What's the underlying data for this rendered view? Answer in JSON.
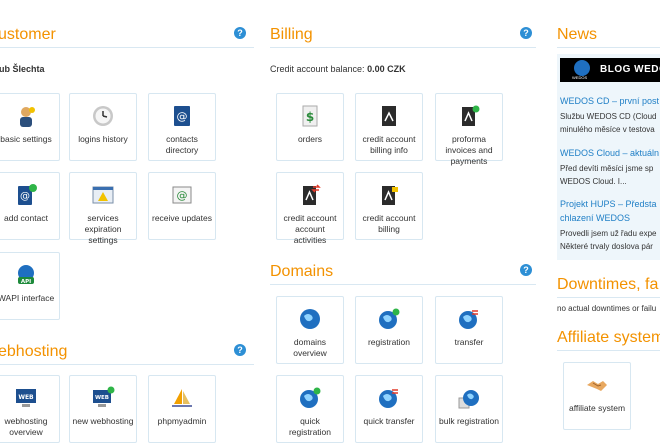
{
  "customer": {
    "title": "ustomer",
    "name": "ub Šlechta",
    "tiles": [
      {
        "label": "basic settings"
      },
      {
        "label": "logins history"
      },
      {
        "label": "contacts directory"
      },
      {
        "label": "add contact"
      },
      {
        "label": "services expiration settings"
      },
      {
        "label": "receive updates"
      },
      {
        "label": "WAPI interface"
      }
    ]
  },
  "webhosting": {
    "title": "ebhosting",
    "tiles": [
      {
        "label": "webhosting overview"
      },
      {
        "label": "new webhosting"
      },
      {
        "label": "phpmyadmin"
      }
    ]
  },
  "billing": {
    "title": "Billing",
    "balance_label": "Credit account balance:",
    "balance_value": "0.00 CZK",
    "tiles": [
      {
        "label": "orders"
      },
      {
        "label": "credit account billing info"
      },
      {
        "label": "proforma invoices and payments"
      },
      {
        "label": "credit account account activities"
      },
      {
        "label": "credit account billing"
      }
    ]
  },
  "domains": {
    "title": "Domains",
    "tiles": [
      {
        "label": "domains overview"
      },
      {
        "label": "registration"
      },
      {
        "label": "transfer"
      },
      {
        "label": "quick registration"
      },
      {
        "label": "quick transfer"
      },
      {
        "label": "bulk registration"
      }
    ]
  },
  "news": {
    "title": "News",
    "banner_text": "BLOG WEDO",
    "banner_logo_text": "WEDOS",
    "items": [
      {
        "title": "WEDOS CD – první post",
        "lines": [
          "Službu WEDOS CD (Cloud",
          "minulého měsíce v testova"
        ]
      },
      {
        "title": "WEDOS Cloud – aktuáln",
        "lines": [
          "Před devíti měsíci jsme sp",
          "WEDOS Cloud. I..."
        ]
      },
      {
        "title": "Projekt HUPS – Předsta",
        "title2": "chlazení WEDOS",
        "lines": [
          "Provedli jsem už řadu expe",
          "Některé trvaly doslova pár"
        ]
      }
    ]
  },
  "downtimes": {
    "title": "Downtimes, fa",
    "text": "no actual downtimes or failu"
  },
  "affiliate": {
    "title": "Affiliate system",
    "tiles": [
      {
        "label": "affiliate system"
      }
    ]
  },
  "help_symbol": "?",
  "colors": {
    "accent": "#f39200",
    "link": "#1f7fc6",
    "help": "#2d8fd5",
    "tile_border": "#d7e7f1"
  }
}
